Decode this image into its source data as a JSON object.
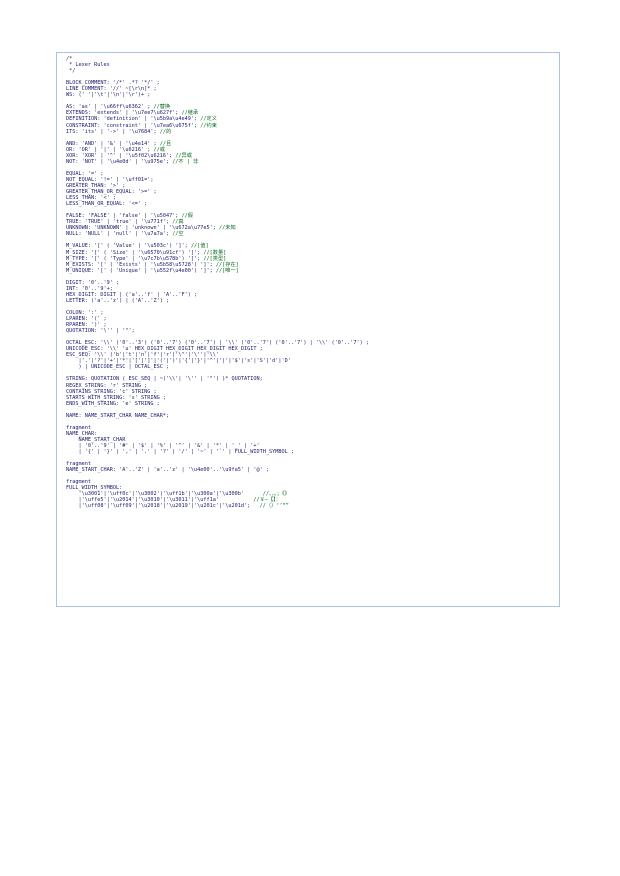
{
  "code_lines": [
    {
      "text": "/*",
      "comment": ""
    },
    {
      "text": " * Lexer Rules",
      "comment": ""
    },
    {
      "text": " */",
      "comment": ""
    },
    {
      "text": "",
      "comment": ""
    },
    {
      "text": "BLOCK_COMMENT: '/*' .*? '*/' ;",
      "comment": ""
    },
    {
      "text": "LINE_COMMENT: '//' ~[\\r\\n]* ;",
      "comment": ""
    },
    {
      "text": "WS: (' '|'\\t'|'\\n'|'\\r')+ ;",
      "comment": ""
    },
    {
      "text": "",
      "comment": ""
    },
    {
      "text": "AS: 'as' | '\\u66ff\\u6362' ; ",
      "comment": "//替换"
    },
    {
      "text": "EXTENDS: 'extends' | '\\u7ee7\\u627f'; ",
      "comment": "//继承"
    },
    {
      "text": "DEFINITION: 'definition' | '\\u5b9a\\u4e49'; ",
      "comment": "//定义"
    },
    {
      "text": "CONSTRAINT: 'constraint' | '\\u7ea6\\u675f'; ",
      "comment": "//约束"
    },
    {
      "text": "ITS: 'its' | '->' | '\\u7684'; ",
      "comment": "//的"
    },
    {
      "text": "",
      "comment": ""
    },
    {
      "text": "AND: 'AND' | '&' | '\\u4e14' ; ",
      "comment": "//且"
    },
    {
      "text": "OR: 'OR' | '|' | '\\u6216' ; ",
      "comment": "//或"
    },
    {
      "text": "XOR: 'XOR' | '^' | '\\u5f02\\u6216'; ",
      "comment": "//异或"
    },
    {
      "text": "NOT: 'NOT' | '\\u4e0d' | '\\u975e'; ",
      "comment": "//不 | 非"
    },
    {
      "text": "",
      "comment": ""
    },
    {
      "text": "EQUAL: '=' ;",
      "comment": ""
    },
    {
      "text": "NOT_EQUAL: '!=' | '\\uff01=';",
      "comment": ""
    },
    {
      "text": "GREATER_THAN: '>' ;",
      "comment": ""
    },
    {
      "text": "GREATER_THAN_OR_EQUAL: '>=' ;",
      "comment": ""
    },
    {
      "text": "LESS_THAN: '<' ;",
      "comment": ""
    },
    {
      "text": "LESS_THAN_OR_EQUAL: '<=' ;",
      "comment": ""
    },
    {
      "text": "",
      "comment": ""
    },
    {
      "text": "FALSE: 'FALSE' | 'false' | '\\u5047'; ",
      "comment": "//假"
    },
    {
      "text": "TRUE: 'TRUE' | 'true' | '\\u771f'; ",
      "comment": "//真"
    },
    {
      "text": "UNKNOWN: 'UNKNOWN' | 'unknown' | '\\u672a\\u77e5'; ",
      "comment": "//未知"
    },
    {
      "text": "NULL: 'NULL' | 'null' | '\\u7a7a'; ",
      "comment": "//空"
    },
    {
      "text": "",
      "comment": ""
    },
    {
      "text": "M_VALUE: '[' ( 'Value' | '\\u503c') ']'; ",
      "comment": "//[值]"
    },
    {
      "text": "M_SIZE: '[' ( 'Size' | '\\u6570\\u91cf') ']'; ",
      "comment": "//[数量]"
    },
    {
      "text": "M_TYPE: '[' ( 'Type' | '\\u7c7b\\u578b') ']'; ",
      "comment": "//[类型]"
    },
    {
      "text": "M_EXISTS: '[' ( 'Exists' | '\\u5b58\\u5728') ']'; ",
      "comment": "//[存在]"
    },
    {
      "text": "M_UNIQUE: '[' ( 'Unique' | '\\u552f\\u4e00') ']'; ",
      "comment": "//[唯一]"
    },
    {
      "text": "",
      "comment": ""
    },
    {
      "text": "DIGIT: '0'..'9' ;",
      "comment": ""
    },
    {
      "text": "INT: '0'..'9'+;",
      "comment": ""
    },
    {
      "text": "HEX_DIGIT: DIGIT | ('a'..'f' | 'A'..'F') ;",
      "comment": ""
    },
    {
      "text": "LETTER: ('a'..'z') | ('A'..'Z') ;",
      "comment": ""
    },
    {
      "text": "",
      "comment": ""
    },
    {
      "text": "COLON: ':' ;",
      "comment": ""
    },
    {
      "text": "LPAREN: '(' ;",
      "comment": ""
    },
    {
      "text": "RPAREN: ')' ;",
      "comment": ""
    },
    {
      "text": "QUOTATION: '\\'' | '\"';",
      "comment": ""
    },
    {
      "text": "",
      "comment": ""
    },
    {
      "text": "OCTAL_ESC: '\\\\' ('0'..'3') ('0'..'7') ('0'..'7') | '\\\\' ('0'..'7') ('0'..'7') | '\\\\' ('0'..'7') ;",
      "comment": ""
    },
    {
      "text": "UNICODE_ESC: '\\\\' 'u' HEX_DIGIT HEX_DIGIT HEX_DIGIT HEX_DIGIT ;",
      "comment": ""
    },
    {
      "text": "ESC_SEQ: '\\\\' ('b'|'t'|'n'|'f'|'r'|'\\\"'|'\\''|'\\\\'",
      "comment": ""
    },
    {
      "text": "    |'.'|'?'|'+'|'*'|'['|']'|'('|')'|'{'|'}'|'^'|'|'|'$'|'s'|'S'|'d'|'D'",
      "comment": ""
    },
    {
      "text": "    ) | UNICODE_ESC | OCTAL_ESC ;",
      "comment": ""
    },
    {
      "text": "",
      "comment": ""
    },
    {
      "text": "STRING: QUOTATION ( ESC_SEQ | ~('\\\\'| '\\'' | '\"') )* QUOTATION;",
      "comment": ""
    },
    {
      "text": "REGEX_STRING: 'r' STRING ;",
      "comment": ""
    },
    {
      "text": "CONTAINS_STRING: 'c' STRING ;",
      "comment": ""
    },
    {
      "text": "STARTS_WITH_STRING: 's' STRING ;",
      "comment": ""
    },
    {
      "text": "ENDS_WITH_STRING: 'e' STRING ;",
      "comment": ""
    },
    {
      "text": "",
      "comment": ""
    },
    {
      "text": "NAME: NAME_START_CHAR NAME_CHAR*;",
      "comment": ""
    },
    {
      "text": "",
      "comment": ""
    },
    {
      "text": "fragment",
      "comment": ""
    },
    {
      "text": "NAME_CHAR:",
      "comment": ""
    },
    {
      "text": "    NAME_START_CHAR",
      "comment": ""
    },
    {
      "text": "    | '0'..'9' | '#' | '$' | '%' | '^' | '&' | '*' | '_' | '+'",
      "comment": ""
    },
    {
      "text": "    | '{' | '}' | ',' | '.' | '?' | '/' | '~' | '`' | FULL_WIDTH_SYMBOL ;",
      "comment": ""
    },
    {
      "text": "",
      "comment": ""
    },
    {
      "text": "fragment",
      "comment": ""
    },
    {
      "text": "NAME_START_CHAR: 'A'..'Z' | 'a'..'z' | '\\u4e00'..'\\u9fa5' | '@' ;",
      "comment": ""
    },
    {
      "text": "",
      "comment": ""
    },
    {
      "text": "fragment",
      "comment": ""
    },
    {
      "text": "FULL_WIDTH_SYMBOL:",
      "comment": ""
    },
    {
      "text": "    '\\u3001'|'\\uff0c'|'\\u3002'|'\\uff1b'|'\\u300a'|'\\u300b'      ",
      "comment": "//、，。；《》"
    },
    {
      "text": "    |'\\uffe5'|'\\u2014'|'\\u3010'|'\\u3011'|'\\uff1a'           ",
      "comment": "//￥—【】："
    },
    {
      "text": "    |'\\uff08'|'\\uff09'|'\\u2018'|'\\u2019'|'\\u201c'|'\\u201d';   ",
      "comment": "//（）‘’“”"
    }
  ]
}
